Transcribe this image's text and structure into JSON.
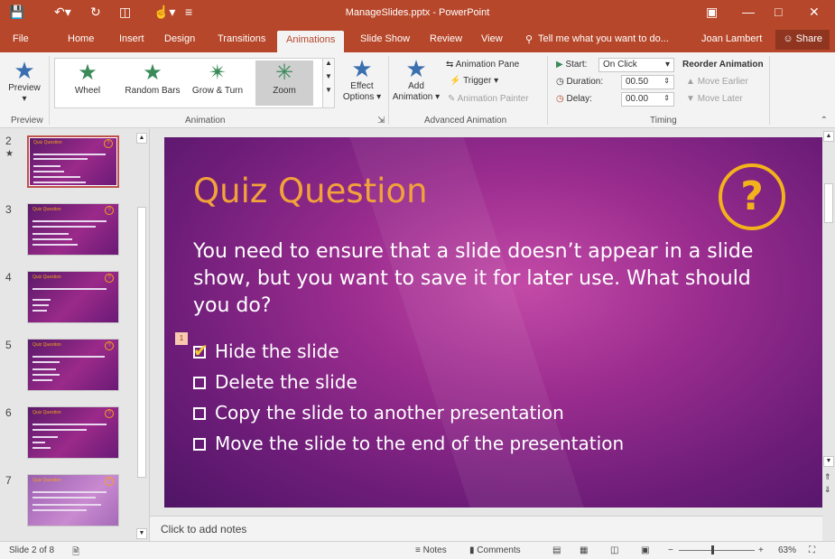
{
  "titlebar": {
    "title": "ManageSlides.pptx - PowerPoint",
    "save_icon": "save-icon",
    "undo_icon": "undo-icon",
    "redo_icon": "redo-icon"
  },
  "tabs": {
    "file": "File",
    "home": "Home",
    "insert": "Insert",
    "design": "Design",
    "transitions": "Transitions",
    "animations": "Animations",
    "slideshow": "Slide Show",
    "review": "Review",
    "view": "View",
    "tellme": "Tell me what you want to do...",
    "user": "Joan Lambert",
    "share": "Share"
  },
  "ribbon": {
    "preview_label": "Preview",
    "preview_group": "Preview",
    "animation_group": "Animation",
    "advanced_group": "Advanced Animation",
    "timing_group": "Timing",
    "gallery": [
      "Wheel",
      "Random Bars",
      "Grow & Turn",
      "Zoom"
    ],
    "gallery_selected": "Zoom",
    "effect_options": "Effect Options",
    "add_animation": "Add Animation",
    "animation_pane": "Animation Pane",
    "trigger": "Trigger",
    "animation_painter": "Animation Painter",
    "start_label": "Start:",
    "start_value": "On Click",
    "duration_label": "Duration:",
    "duration_value": "00.50",
    "delay_label": "Delay:",
    "delay_value": "00.00",
    "reorder": "Reorder Animation",
    "move_earlier": "Move Earlier",
    "move_later": "Move Later"
  },
  "thumbnails": [
    {
      "num": "2",
      "star": "★",
      "selected": true
    },
    {
      "num": "3"
    },
    {
      "num": "4"
    },
    {
      "num": "5"
    },
    {
      "num": "6"
    },
    {
      "num": "7"
    }
  ],
  "slide": {
    "title": "Quiz Question",
    "badge": "?",
    "question": "You need to ensure that a slide doesn’t appear in a slide show, but you want to save it for later use. What should you do?",
    "anim_marker": "1",
    "options": [
      {
        "label": "Hide the slide",
        "checked": true
      },
      {
        "label": "Delete the slide",
        "checked": false
      },
      {
        "label": "Copy the slide to another presentation",
        "checked": false
      },
      {
        "label": "Move the slide to the end of the presentation",
        "checked": false
      }
    ],
    "thumb_title": "Quiz Question"
  },
  "notes": {
    "placeholder": "Click to add notes"
  },
  "status": {
    "slide_count": "Slide 2 of 8",
    "notes": "Notes",
    "comments": "Comments",
    "zoom": "63%"
  },
  "colors": {
    "accent": "#b7472a",
    "title_orange": "#f2a23a",
    "badge_gold": "#f3b21b",
    "slide_purple": "#9b2d8f"
  }
}
